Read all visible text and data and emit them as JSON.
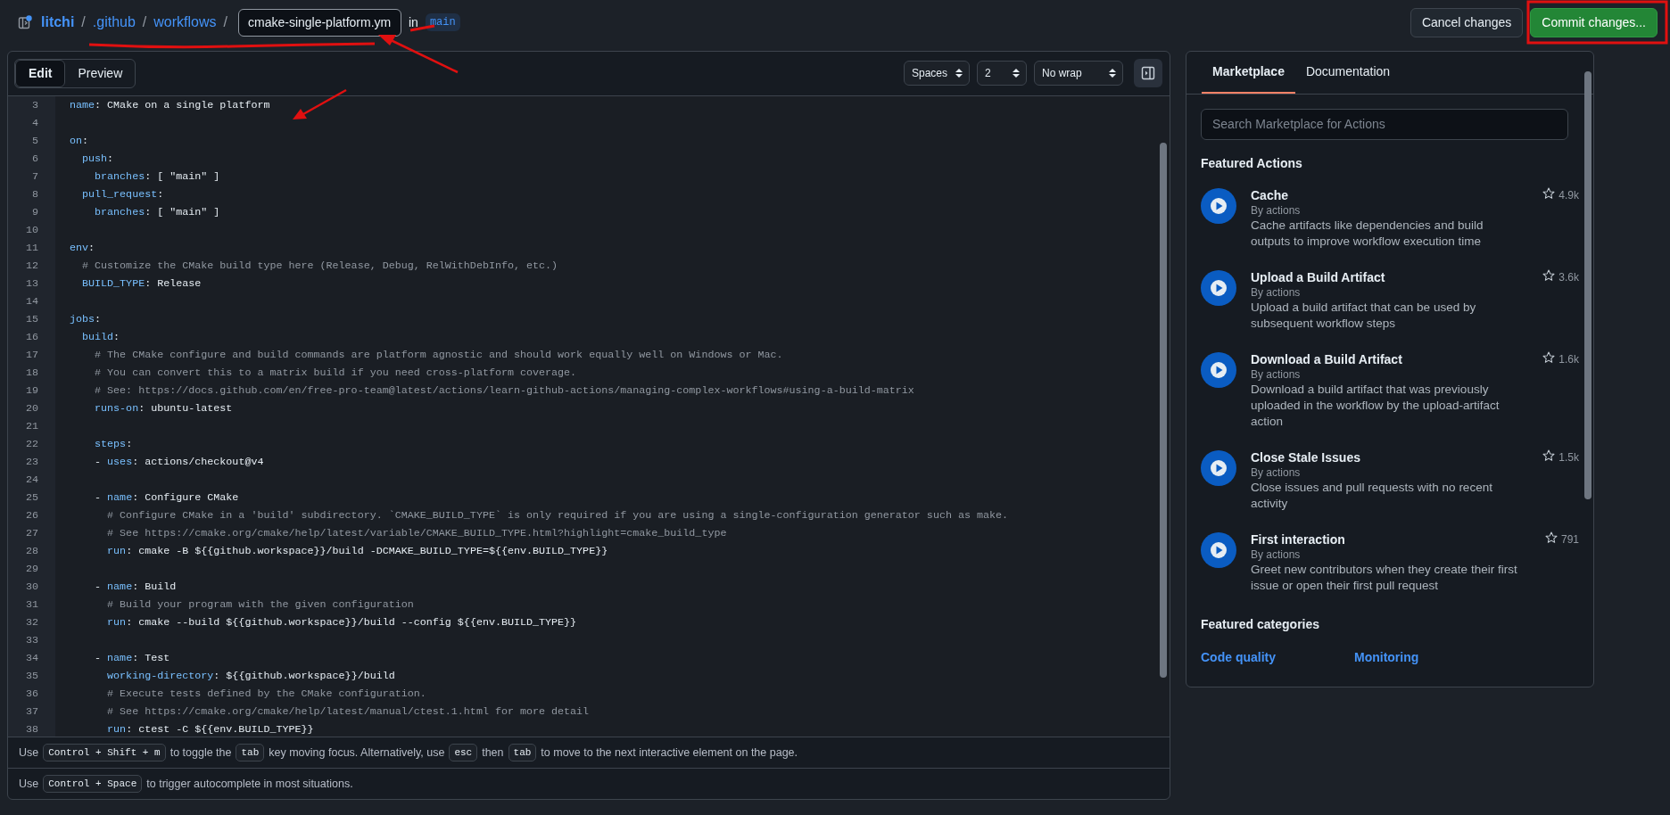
{
  "header": {
    "crumbs": [
      {
        "text": "litchi",
        "kind": "repo"
      },
      {
        "text": ".github",
        "kind": "folder"
      },
      {
        "text": "workflows",
        "kind": "folder"
      }
    ],
    "separator": "/",
    "filename": "cmake-single-platform.ym",
    "in_label": "in",
    "branch": "main",
    "buttons": [
      {
        "label": "Cancel changes",
        "kind": "secondary"
      },
      {
        "label": "Commit changes...",
        "kind": "primary"
      }
    ]
  },
  "editor": {
    "modes": [
      {
        "label": "Edit",
        "selected": true
      },
      {
        "label": "Preview",
        "selected": false
      }
    ],
    "indent_mode": "Spaces",
    "indent_size": "2",
    "wrap_mode": "No wrap",
    "lines": [
      {
        "number": "3",
        "tokens": [
          {
            "kind": "key",
            "text": "name"
          },
          {
            "kind": "plain",
            "text": ": CMake on a single platform"
          }
        ]
      },
      {
        "number": "4"
      },
      {
        "number": "5",
        "tokens": [
          {
            "kind": "key",
            "text": "on"
          },
          {
            "kind": "plain",
            "text": ":"
          }
        ]
      },
      {
        "number": "6",
        "tokens": [
          {
            "kind": "key",
            "text": "  push"
          },
          {
            "kind": "plain",
            "text": ":"
          }
        ]
      },
      {
        "number": "7",
        "tokens": [
          {
            "kind": "key",
            "text": "    branches"
          },
          {
            "kind": "plain",
            "text": ": [ \"main\" ]"
          }
        ]
      },
      {
        "number": "8",
        "tokens": [
          {
            "kind": "key",
            "text": "  pull_request"
          },
          {
            "kind": "plain",
            "text": ":"
          }
        ]
      },
      {
        "number": "9",
        "tokens": [
          {
            "kind": "key",
            "text": "    branches"
          },
          {
            "kind": "plain",
            "text": ": [ \"main\" ]"
          }
        ]
      },
      {
        "number": "10"
      },
      {
        "number": "11",
        "tokens": [
          {
            "kind": "key",
            "text": "env"
          },
          {
            "kind": "plain",
            "text": ":"
          }
        ]
      },
      {
        "number": "12",
        "tokens": [
          {
            "kind": "comment",
            "text": "  # Customize the CMake build type here (Release, Debug, RelWithDebInfo, etc.)"
          }
        ]
      },
      {
        "number": "13",
        "tokens": [
          {
            "kind": "key",
            "text": "  BUILD_TYPE"
          },
          {
            "kind": "plain",
            "text": ": Release"
          }
        ]
      },
      {
        "number": "14"
      },
      {
        "number": "15",
        "tokens": [
          {
            "kind": "key",
            "text": "jobs"
          },
          {
            "kind": "plain",
            "text": ":"
          }
        ]
      },
      {
        "number": "16",
        "tokens": [
          {
            "kind": "key",
            "text": "  build"
          },
          {
            "kind": "plain",
            "text": ":"
          }
        ]
      },
      {
        "number": "17",
        "tokens": [
          {
            "kind": "comment",
            "text": "    # The CMake configure and build commands are platform agnostic and should work equally well on Windows or Mac."
          }
        ]
      },
      {
        "number": "18",
        "tokens": [
          {
            "kind": "comment",
            "text": "    # You can convert this to a matrix build if you need cross-platform coverage."
          }
        ]
      },
      {
        "number": "19",
        "tokens": [
          {
            "kind": "comment",
            "text": "    # See: https://docs.github.com/en/free-pro-team@latest/actions/learn-github-actions/managing-complex-workflows#using-a-build-matrix"
          }
        ]
      },
      {
        "number": "20",
        "tokens": [
          {
            "kind": "key",
            "text": "    runs-on"
          },
          {
            "kind": "plain",
            "text": ": ubuntu-latest"
          }
        ]
      },
      {
        "number": "21"
      },
      {
        "number": "22",
        "tokens": [
          {
            "kind": "key",
            "text": "    steps"
          },
          {
            "kind": "plain",
            "text": ":"
          }
        ]
      },
      {
        "number": "23",
        "tokens": [
          {
            "kind": "plain",
            "text": "    - "
          },
          {
            "kind": "key",
            "text": "uses"
          },
          {
            "kind": "plain",
            "text": ": actions/checkout@v4"
          }
        ]
      },
      {
        "number": "24"
      },
      {
        "number": "25",
        "tokens": [
          {
            "kind": "plain",
            "text": "    - "
          },
          {
            "kind": "key",
            "text": "name"
          },
          {
            "kind": "plain",
            "text": ": Configure CMake"
          }
        ]
      },
      {
        "number": "26",
        "tokens": [
          {
            "kind": "comment",
            "text": "      # Configure CMake in a 'build' subdirectory. `CMAKE_BUILD_TYPE` is only required if you are using a single-configuration generator such as make."
          }
        ]
      },
      {
        "number": "27",
        "tokens": [
          {
            "kind": "comment",
            "text": "      # See https://cmake.org/cmake/help/latest/variable/CMAKE_BUILD_TYPE.html?highlight=cmake_build_type"
          }
        ]
      },
      {
        "number": "28",
        "tokens": [
          {
            "kind": "key",
            "text": "      run"
          },
          {
            "kind": "plain",
            "text": ": cmake -B ${{github.workspace}}/build -DCMAKE_BUILD_TYPE=${{env.BUILD_TYPE}}"
          }
        ]
      },
      {
        "number": "29"
      },
      {
        "number": "30",
        "tokens": [
          {
            "kind": "plain",
            "text": "    - "
          },
          {
            "kind": "key",
            "text": "name"
          },
          {
            "kind": "plain",
            "text": ": Build"
          }
        ]
      },
      {
        "number": "31",
        "tokens": [
          {
            "kind": "comment",
            "text": "      # Build your program with the given configuration"
          }
        ]
      },
      {
        "number": "32",
        "tokens": [
          {
            "kind": "key",
            "text": "      run"
          },
          {
            "kind": "plain",
            "text": ": cmake --build ${{github.workspace}}/build --config ${{env.BUILD_TYPE}}"
          }
        ]
      },
      {
        "number": "33"
      },
      {
        "number": "34",
        "tokens": [
          {
            "kind": "plain",
            "text": "    - "
          },
          {
            "kind": "key",
            "text": "name"
          },
          {
            "kind": "plain",
            "text": ": Test"
          }
        ]
      },
      {
        "number": "35",
        "tokens": [
          {
            "kind": "key",
            "text": "      working-directory"
          },
          {
            "kind": "plain",
            "text": ": ${{github.workspace}}/build"
          }
        ]
      },
      {
        "number": "36",
        "tokens": [
          {
            "kind": "comment",
            "text": "      # Execute tests defined by the CMake configuration."
          }
        ]
      },
      {
        "number": "37",
        "tokens": [
          {
            "kind": "comment",
            "text": "      # See https://cmake.org/cmake/help/latest/manual/ctest.1.html for more detail"
          }
        ]
      },
      {
        "number": "38",
        "tokens": [
          {
            "kind": "key",
            "text": "      run"
          },
          {
            "kind": "plain",
            "text": ": ctest -C ${{env.BUILD_TYPE}}"
          }
        ]
      }
    ],
    "hints": [
      {
        "parts": [
          {
            "kind": "text",
            "text": "Use"
          },
          {
            "kind": "key",
            "text": "Control + Shift + m"
          },
          {
            "kind": "text",
            "text": "to toggle the"
          },
          {
            "kind": "key",
            "text": "tab"
          },
          {
            "kind": "text",
            "text": "key moving focus. Alternatively, use"
          },
          {
            "kind": "key",
            "text": "esc"
          },
          {
            "kind": "text",
            "text": "then"
          },
          {
            "kind": "key",
            "text": "tab"
          },
          {
            "kind": "text",
            "text": "to move to the next interactive element on the page."
          }
        ]
      },
      {
        "parts": [
          {
            "kind": "text",
            "text": "Use"
          },
          {
            "kind": "key",
            "text": "Control + Space"
          },
          {
            "kind": "text",
            "text": "to trigger autocomplete in most situations."
          }
        ]
      }
    ]
  },
  "panel": {
    "tabs": [
      {
        "label": "Marketplace",
        "selected": true
      },
      {
        "label": "Documentation",
        "selected": false
      }
    ],
    "search": {
      "placeholder": "Search Marketplace for Actions"
    },
    "featured_title": "Featured Actions",
    "actions": [
      {
        "title": "Cache",
        "author": "By actions",
        "description": "Cache artifacts like dependencies and build outputs to improve workflow execution time",
        "stars": "4.9k"
      },
      {
        "title": "Upload a Build Artifact",
        "author": "By actions",
        "description": "Upload a build artifact that can be used by subsequent workflow steps",
        "stars": "3.6k"
      },
      {
        "title": "Download a Build Artifact",
        "author": "By actions",
        "description": "Download a build artifact that was previously uploaded in the workflow by the upload-artifact action",
        "stars": "1.6k"
      },
      {
        "title": "Close Stale Issues",
        "author": "By actions",
        "description": "Close issues and pull requests with no recent activity",
        "stars": "1.5k"
      },
      {
        "title": "First interaction",
        "author": "By actions",
        "description": "Greet new contributors when they create their first issue or open their first pull request",
        "stars": "791"
      }
    ],
    "categories_title": "Featured categories",
    "categories": [
      "Code quality",
      "Monitoring"
    ]
  }
}
